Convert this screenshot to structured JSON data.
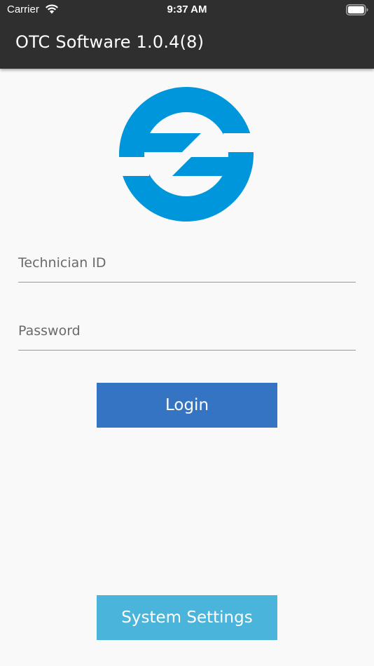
{
  "status_bar": {
    "carrier": "Carrier",
    "time": "9:37 AM",
    "wifi_icon": "wifi-icon",
    "battery_icon": "battery-full-icon"
  },
  "app_bar": {
    "title": "OTC Software 1.0.4(8)",
    "background_color": "#2f2f2f"
  },
  "logo": {
    "icon": "otc-logo",
    "color": "#0096db"
  },
  "form": {
    "technician_id": {
      "placeholder": "Technician ID",
      "value": ""
    },
    "password": {
      "placeholder": "Password",
      "value": ""
    },
    "login_label": "Login",
    "login_color": "#3474c3"
  },
  "footer": {
    "settings_label": "System Settings",
    "settings_color": "#4ab4db"
  }
}
